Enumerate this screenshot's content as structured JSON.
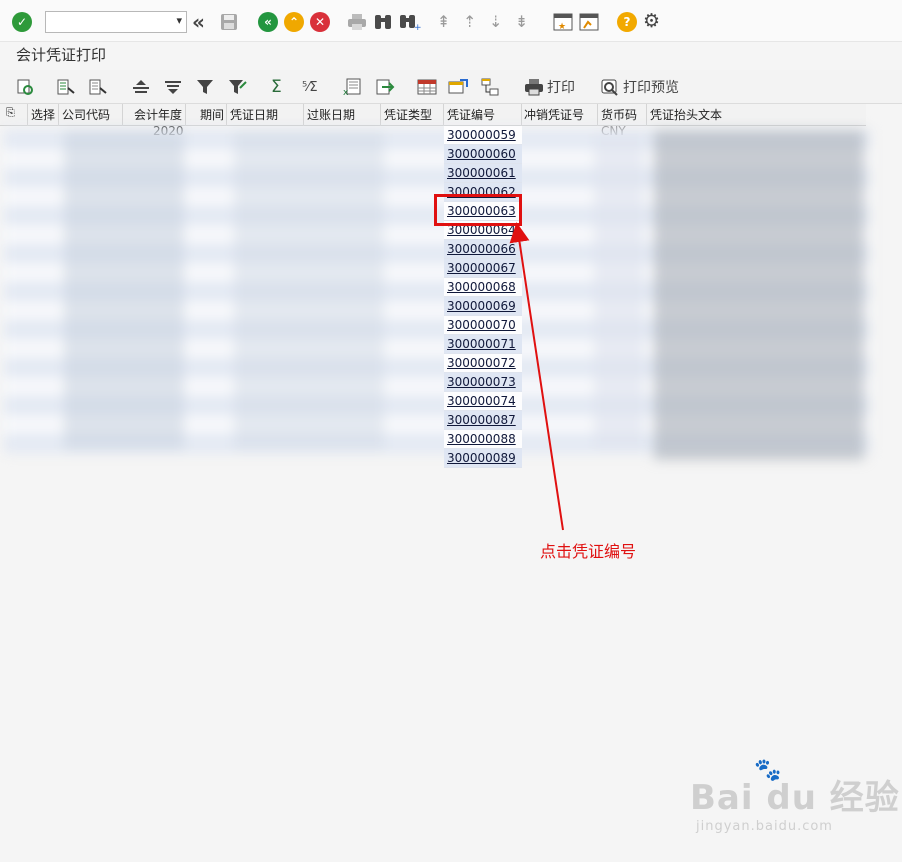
{
  "window": {
    "title": "会计凭证打印"
  },
  "toolbar": {
    "command_field_value": "",
    "print_label": "打印",
    "print_preview_label": "打印预览"
  },
  "grid": {
    "columns": [
      "选择",
      "公司代码",
      "会计年度",
      "期间",
      "凭证日期",
      "过账日期",
      "凭证类型",
      "凭证编号",
      "冲销凭证号",
      "货币码",
      "凭证抬头文本"
    ],
    "first_row_partial": {
      "fiscal_year": "2020",
      "currency": "CNY"
    },
    "voucher_numbers": [
      "300000059",
      "300000060",
      "300000061",
      "300000062",
      "300000063",
      "300000064",
      "300000066",
      "300000067",
      "300000068",
      "300000069",
      "300000070",
      "300000071",
      "300000072",
      "300000073",
      "300000074",
      "300000087",
      "300000088",
      "300000089"
    ]
  },
  "annotation": {
    "text": "点击凭证编号",
    "color": "#e01010",
    "highlighted_voucher": "300000063"
  },
  "watermark": {
    "brand": "Bai du 经验",
    "url": "jingyan.baidu.com"
  },
  "colors": {
    "ok_green": "#2e9a3a",
    "back_green": "#23963f",
    "exit_yellow": "#f0a800",
    "cancel_red": "#d9303a",
    "help_yellow": "#f2a900",
    "row_alt": "#dfe6f3"
  }
}
